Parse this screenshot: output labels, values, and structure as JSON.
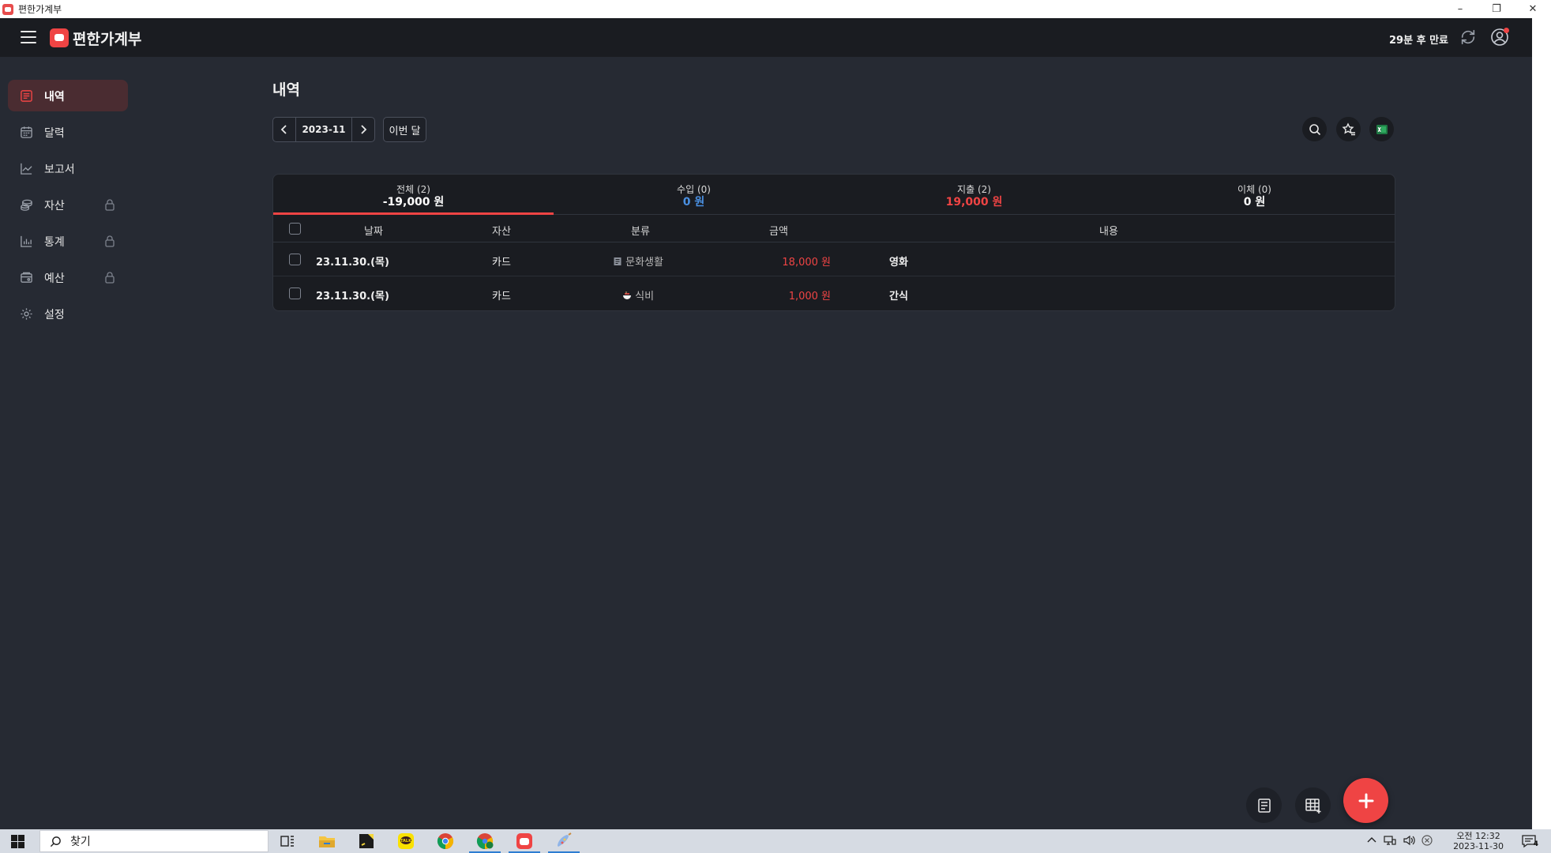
{
  "window": {
    "title": "편한가계부",
    "minimize": "–",
    "restore": "❐",
    "close": "✕"
  },
  "header": {
    "app_name": "편한가계부",
    "expiry": "29분 후 만료"
  },
  "sidebar": {
    "items": [
      {
        "label": "내역",
        "icon": "list-icon",
        "active": true,
        "locked": false
      },
      {
        "label": "달력",
        "icon": "calendar-icon",
        "active": false,
        "locked": false
      },
      {
        "label": "보고서",
        "icon": "chart-line-icon",
        "active": false,
        "locked": false
      },
      {
        "label": "자산",
        "icon": "coins-icon",
        "active": false,
        "locked": true
      },
      {
        "label": "통계",
        "icon": "bar-chart-icon",
        "active": false,
        "locked": true
      },
      {
        "label": "예산",
        "icon": "budget-icon",
        "active": false,
        "locked": true
      },
      {
        "label": "설정",
        "icon": "gear-icon",
        "active": false,
        "locked": false
      }
    ]
  },
  "main": {
    "title": "내역",
    "month": "2023-11",
    "this_month_label": "이번 달",
    "tabs": [
      {
        "label": "전체 (2)",
        "value": "-19,000 원"
      },
      {
        "label": "수입 (0)",
        "value": "0 원"
      },
      {
        "label": "지출 (2)",
        "value": "19,000 원"
      },
      {
        "label": "이체 (0)",
        "value": "0 원"
      }
    ],
    "columns": [
      "날짜",
      "자산",
      "분류",
      "금액",
      "내용"
    ],
    "rows": [
      {
        "date": "23.11.30.(목)",
        "asset": "카드",
        "category": "문화생활",
        "category_icon": "receipt-icon",
        "amount": "18,000 원",
        "memo": "영화"
      },
      {
        "date": "23.11.30.(목)",
        "asset": "카드",
        "category": "식비",
        "category_icon": "bowl-icon",
        "amount": "1,000 원",
        "memo": "간식"
      }
    ]
  },
  "taskbar": {
    "search_placeholder": "찾기",
    "time": "오전 12:32",
    "date": "2023-11-30",
    "notification_count": "4"
  },
  "colors": {
    "accent": "#ef4444",
    "income": "#4a90e2",
    "background": "#262a33",
    "panel": "#1a1c21"
  }
}
